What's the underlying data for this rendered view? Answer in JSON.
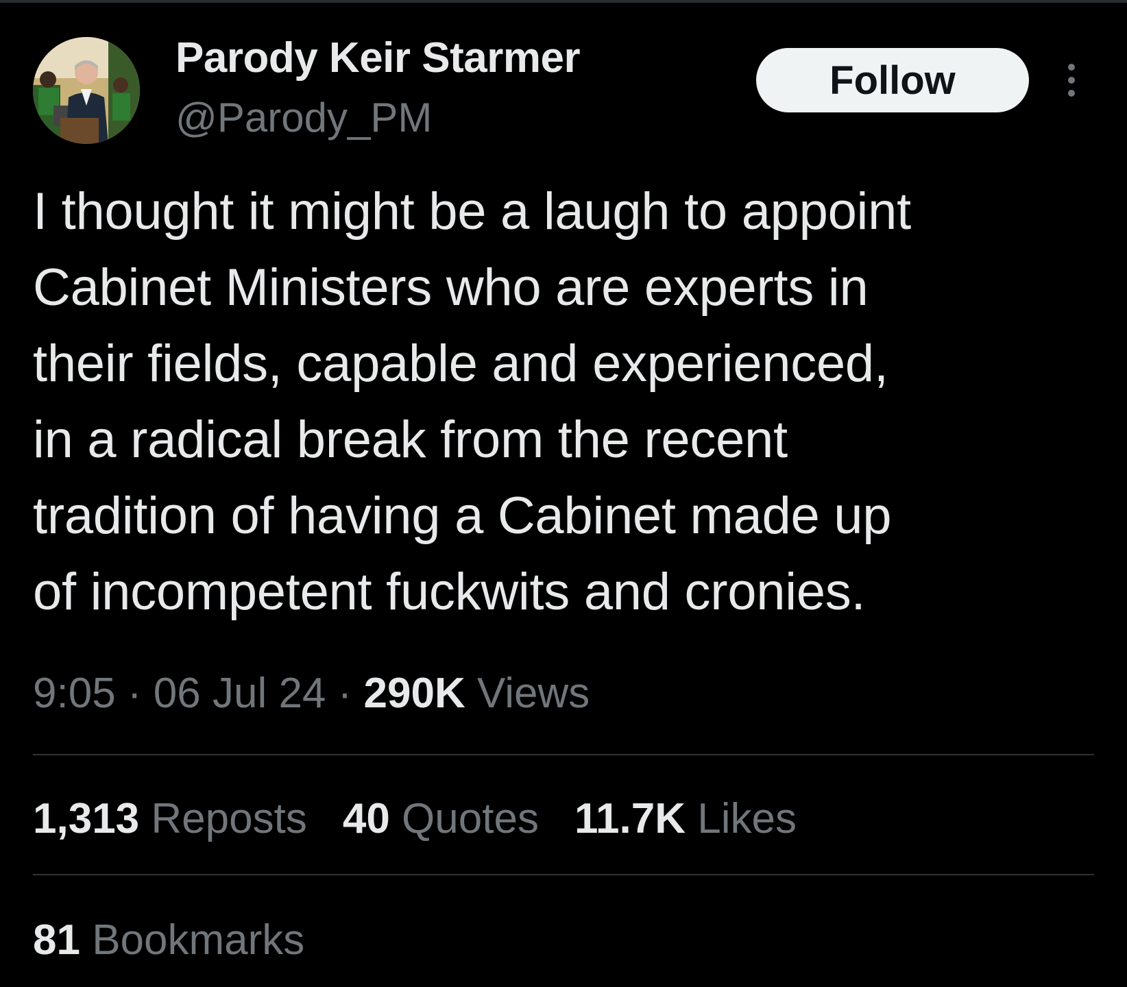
{
  "author": {
    "display_name": "Parody Keir Starmer",
    "handle": "@Parody_PM",
    "avatar_icon": "profile-photo"
  },
  "follow_button": {
    "label": "Follow"
  },
  "more_icon": "more-options-vertical-icon",
  "tweet": {
    "text": "I thought it might be a laugh to appoint\nCabinet Ministers who are experts in\ntheir fields, capable and experienced,\nin a radical break from the recent\ntradition of having a Cabinet made up\nof incompetent fuckwits and cronies."
  },
  "meta": {
    "time": "9:05",
    "separator": " · ",
    "date": "06 Jul 24",
    "views_count": "290K",
    "views_label": "Views"
  },
  "stats": {
    "reposts_count": "1,313",
    "reposts_label": "Reposts",
    "quotes_count": "40",
    "quotes_label": "Quotes",
    "likes_count": "11.7K",
    "likes_label": "Likes",
    "bookmarks_count": "81",
    "bookmarks_label": "Bookmarks"
  },
  "colors": {
    "background": "#000000",
    "primary_text": "#e7e9ea",
    "secondary_text": "#71767b",
    "divider": "#2f3336",
    "follow_button_bg": "#eff3f4"
  }
}
